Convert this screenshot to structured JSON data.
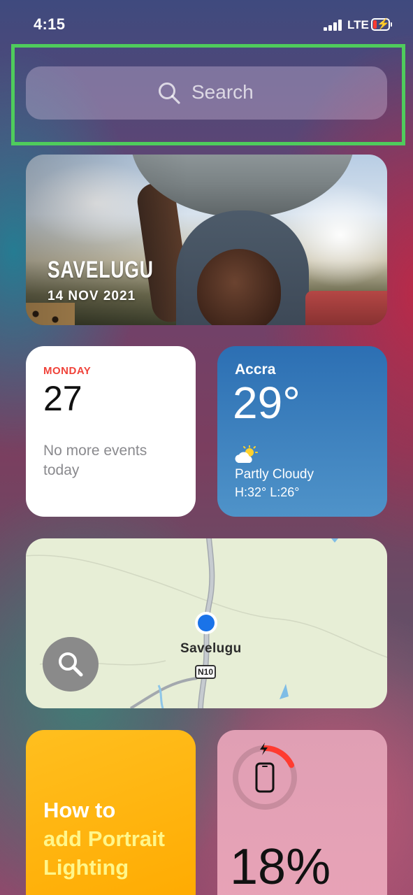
{
  "status_bar": {
    "time": "4:15",
    "network": "LTE",
    "battery_percent": 18,
    "charging": true
  },
  "search": {
    "placeholder": "Search",
    "icon": "search-icon"
  },
  "photo_widget": {
    "title": "SAVELUGU",
    "date": "14 NOV 2021"
  },
  "calendar_widget": {
    "day": "MONDAY",
    "date": "27",
    "events_text": "No more events today"
  },
  "weather_widget": {
    "city": "Accra",
    "temperature": "29°",
    "icon": "partly-cloudy-icon",
    "condition": "Partly Cloudy",
    "high_low": "H:32° L:26°"
  },
  "map_widget": {
    "location_label": "Savelugu",
    "road_label": "N10",
    "search_icon": "search-icon"
  },
  "tips_widget": {
    "line1": "How to",
    "line2": "add Portrait",
    "line3": "Lighting"
  },
  "battery_widget": {
    "percent_label": "18%",
    "level": 0.18,
    "icon": "phone-icon",
    "charging_icon": "bolt-icon"
  },
  "colors": {
    "highlight": "#4fcc5c",
    "calendar_accent": "#f0433a",
    "tips_background": "#ffb300",
    "tips_accent": "#fff68a",
    "battery_ring": "#ff3b30",
    "weather_background": "#3a80bf"
  }
}
